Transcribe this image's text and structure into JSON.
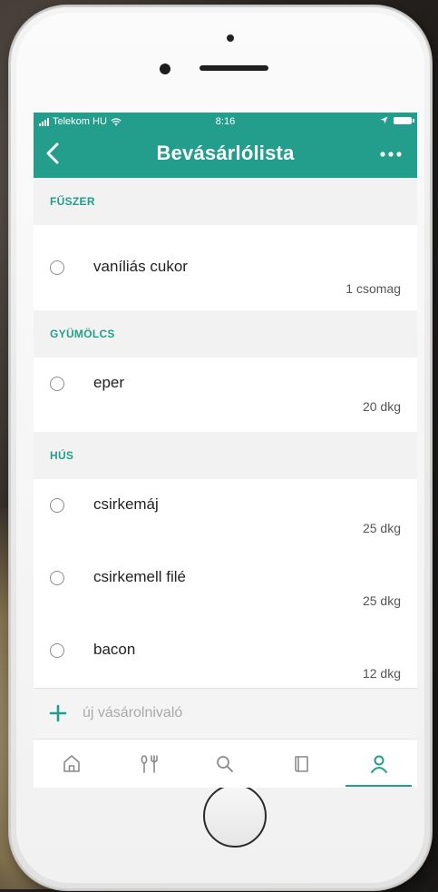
{
  "colors": {
    "accent": "#239e8c",
    "text": "#222222",
    "muted": "#555555",
    "placeholder": "#aaaaaa"
  },
  "status_bar": {
    "carrier": "Telekom HU",
    "time": "8:16"
  },
  "nav": {
    "title": "Bevásárlólista",
    "back_icon": "chevron-left-icon",
    "more_icon": "more-horizontal-icon"
  },
  "sections": [
    {
      "title": "FŰSZER",
      "items": [
        {
          "name": "vaníliás cukor",
          "qty": "1 csomag"
        }
      ]
    },
    {
      "title": "GYÜMÖLCS",
      "items": [
        {
          "name": "eper",
          "qty": "20 dkg"
        }
      ]
    },
    {
      "title": "HÚS",
      "items": [
        {
          "name": "csirkemáj",
          "qty": "25 dkg"
        },
        {
          "name": "csirkemell filé",
          "qty": "25 dkg"
        },
        {
          "name": "bacon",
          "qty": "12 dkg"
        }
      ]
    }
  ],
  "add_item": {
    "label": "új vásárolnivaló",
    "icon": "plus-icon"
  },
  "tabs": [
    {
      "icon": "home-icon",
      "active": false
    },
    {
      "icon": "recipes-icon",
      "active": false
    },
    {
      "icon": "search-icon",
      "active": false
    },
    {
      "icon": "book-icon",
      "active": false
    },
    {
      "icon": "profile-icon",
      "active": true
    }
  ]
}
